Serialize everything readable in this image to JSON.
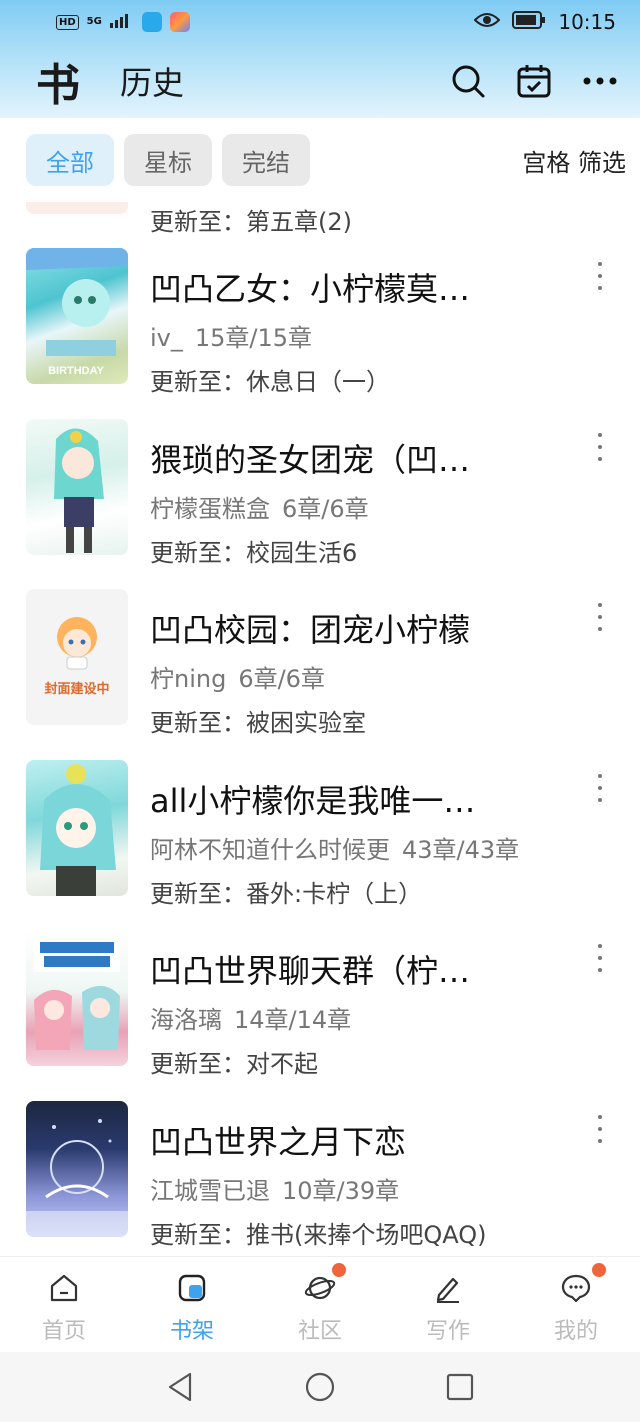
{
  "status_bar": {
    "hd": "HD",
    "network": "5G",
    "time": "10:15",
    "icons": [
      "eye-icon",
      "battery-icon",
      "signal-icon",
      "wifi-icon"
    ]
  },
  "header": {
    "title": "书",
    "subtitle": "历史",
    "icons": [
      "search-icon",
      "calendar-check-icon",
      "more-icon"
    ]
  },
  "filters": {
    "chips": [
      "全部",
      "星标",
      "完结"
    ],
    "active": "全部",
    "grid_filter": "宫格 筛选"
  },
  "partial_item": {
    "update": "更新至：第五章(2)"
  },
  "books": [
    {
      "title": "凹凸乙女：小柠檬莫…",
      "author": "iv_",
      "chapters": "15章/15章",
      "update": "更新至：休息日（一）"
    },
    {
      "title": "猥琐的圣女团宠（凹…",
      "author": "柠檬蛋糕盒",
      "chapters": "6章/6章",
      "update": "更新至：校园生活6"
    },
    {
      "title": "凹凸校园：团宠小柠檬",
      "author": "柠ning",
      "chapters": "6章/6章",
      "update": "更新至：被困实验室",
      "cover_text": "封面建设中"
    },
    {
      "title": "all小柠檬你是我唯一…",
      "author": "阿林不知道什么时候更",
      "chapters": "43章/43章",
      "update": "更新至：番外:卡柠（上）"
    },
    {
      "title": "凹凸世界聊天群（柠…",
      "author": "海洛璃",
      "chapters": "14章/14章",
      "update": "更新至：对不起"
    },
    {
      "title": "凹凸世界之月下恋",
      "author": "江城雪已退",
      "chapters": "10章/39章",
      "update": "更新至：推书(来捧个场吧QAQ)"
    }
  ],
  "tabs": [
    {
      "label": "首页",
      "icon": "home-icon"
    },
    {
      "label": "书架",
      "icon": "bookshelf-icon"
    },
    {
      "label": "社区",
      "icon": "planet-icon"
    },
    {
      "label": "写作",
      "icon": "pen-icon"
    },
    {
      "label": "我的",
      "icon": "chat-bubble-icon"
    }
  ],
  "colors": {
    "accent": "#3ea3ee",
    "badge": "#f0643c",
    "header_top": "#7fcbf4"
  }
}
